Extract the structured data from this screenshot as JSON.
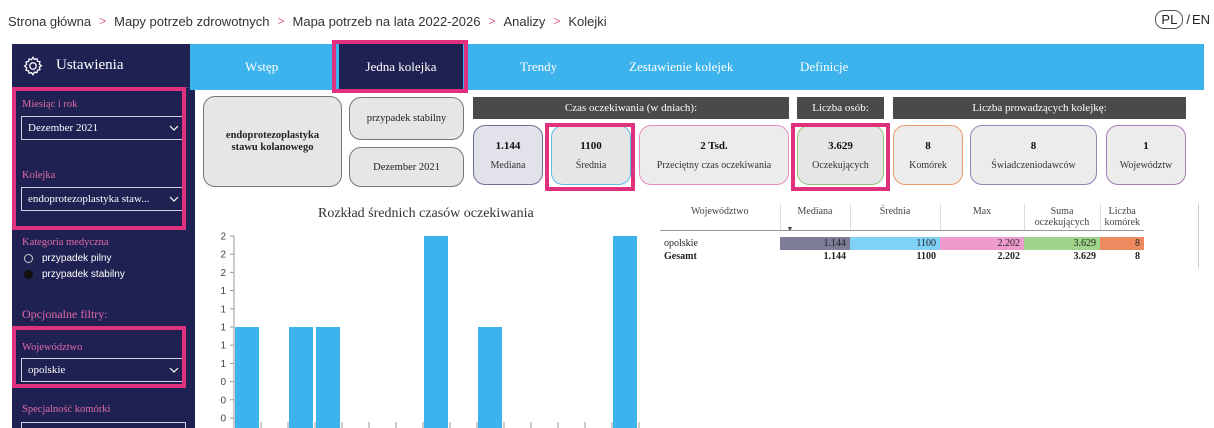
{
  "breadcrumb": [
    "Strona główna",
    "Mapy potrzeb zdrowotnych",
    "Mapa potrzeb na lata 2022-2026",
    "Analizy",
    "Kolejki"
  ],
  "breadcrumb_sep": ">",
  "lang": {
    "current": "PL",
    "sep": "/",
    "other": "EN"
  },
  "sidebar": {
    "title": "Ustawienia",
    "month_label": "Miesiąc i rok",
    "month_value": "Dezember 2021",
    "queue_label": "Kolejka",
    "queue_value": "endoprotezoplastyka staw...",
    "category_label": "Kategoria medyczna",
    "category_options": [
      "przypadek pilny",
      "przypadek stabilny"
    ],
    "category_selected": 1,
    "optional_label": "Opcjonalne filtry:",
    "voivodeship_label": "Województwo",
    "voivodeship_value": "opolskie",
    "specialty_label": "Specjalność komórki"
  },
  "tabs": [
    "Wstęp",
    "Jedna kolejka",
    "Trendy",
    "Zestawienie kolejek",
    "Definicje"
  ],
  "active_tab": 1,
  "info": {
    "procedure": "endoprotezoplastyka stawu kolanowego",
    "case_type": "przypadek stabilny",
    "date": "Dezember 2021"
  },
  "headers": {
    "wait_time": "Czas oczekiwania (w dniach):",
    "persons": "Liczba osób:",
    "providers": "Liczba prowadzących kolejkę:"
  },
  "stats": {
    "median": {
      "value": "1.144",
      "label": "Mediana"
    },
    "mean": {
      "value": "1100",
      "label": "Średnia"
    },
    "avg_wait": {
      "value": "2 Tsd.",
      "label": "Przeciętny czas oczekiwania"
    },
    "waiting": {
      "value": "3.629",
      "label": "Oczekujących"
    },
    "cells": {
      "value": "8",
      "label": "Komórek"
    },
    "providers": {
      "value": "8",
      "label": "Świadczeniodawców"
    },
    "voivodeships": {
      "value": "1",
      "label": "Województw"
    }
  },
  "colors": {
    "sidebar": "#1f2153",
    "tabs": "#3cb3ec",
    "highlight": "#e0317f",
    "label_pink": "#e06aa6",
    "bar": "#3cb3ec"
  },
  "chart_data": {
    "type": "bar",
    "title": "Rozkład średnich czasów oczekiwania",
    "ylim": [
      0,
      2
    ],
    "yticks": [
      "2",
      "2",
      "2",
      "1",
      "1",
      "1",
      "1",
      "1",
      "0",
      "0",
      "0"
    ],
    "values": [
      1,
      0,
      1,
      1,
      0,
      0,
      0,
      2,
      0,
      1,
      0,
      0,
      0,
      0,
      2
    ],
    "xlabel": "",
    "ylabel": ""
  },
  "table": {
    "headers": [
      "Województwo",
      "Mediana",
      "Średnia",
      "Max",
      "Suma oczekujących",
      "Liczba komórek"
    ],
    "rows": [
      [
        "opolskie",
        "1.144",
        "1100",
        "2.202",
        "3.629",
        "8"
      ]
    ],
    "total": [
      "Gesamt",
      "1.144",
      "1100",
      "2.202",
      "3.629",
      "8"
    ],
    "row_colors": [
      "#7d7d97",
      "#7fd2f5",
      "#ee9ccd",
      "#9fd48b",
      "#ee8a5f"
    ]
  }
}
